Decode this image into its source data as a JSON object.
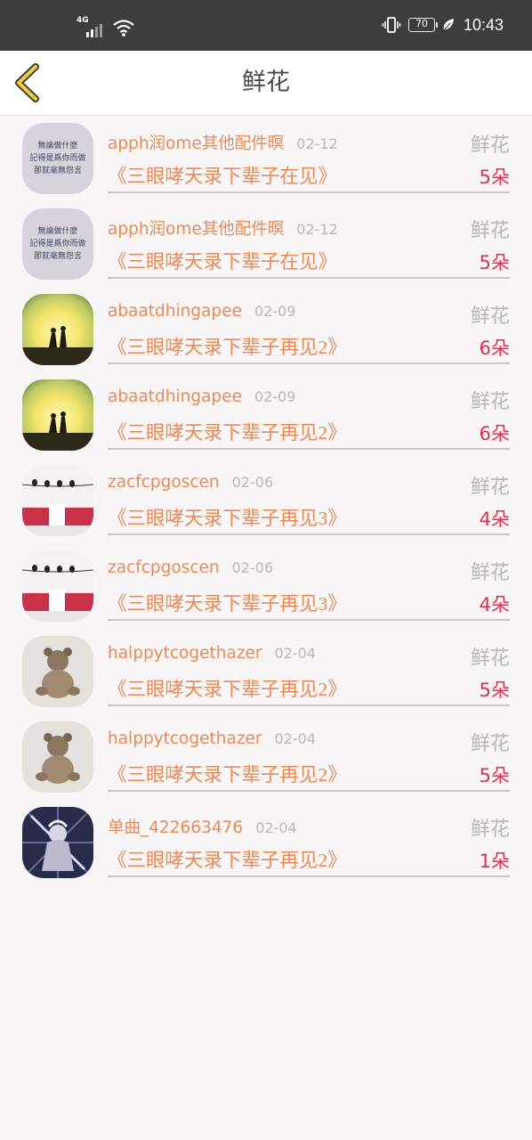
{
  "status_bar": {
    "network": "4G",
    "battery": "70",
    "time": "10:43"
  },
  "header": {
    "title": "鲜花"
  },
  "records": [
    {
      "avatar": "quote-text-image",
      "avatar_text": [
        "無論做什麼",
        "記得是爲你而做",
        "那就毫無怨言"
      ],
      "user": "apph润ome其他配件暝",
      "date": "02-12",
      "tag": "鲜花",
      "song": "《三眼哮天录下辈子在见》",
      "count": "5朵"
    },
    {
      "avatar": "quote-text-image",
      "avatar_text": [
        "無論做什麼",
        "記得是爲你而做",
        "那就毫無怨言"
      ],
      "user": "apph润ome其他配件暝",
      "date": "02-12",
      "tag": "鲜花",
      "song": "《三眼哮天录下辈子在见》",
      "count": "5朵"
    },
    {
      "avatar": "sunset-couple-image",
      "user": "abaatdhingapee",
      "date": "02-09",
      "tag": "鲜花",
      "song": "《三眼哮天录下辈子再见2》",
      "count": "6朵"
    },
    {
      "avatar": "sunset-couple-image",
      "user": "abaatdhingapee",
      "date": "02-09",
      "tag": "鲜花",
      "song": "《三眼哮天录下辈子再见2》",
      "count": "6朵"
    },
    {
      "avatar": "birds-wire-image",
      "user": "zacfcpgoscen",
      "date": "02-06",
      "tag": "鲜花",
      "song": "《三眼哮天录下辈子再见3》",
      "count": "4朵"
    },
    {
      "avatar": "birds-wire-image",
      "user": "zacfcpgoscen",
      "date": "02-06",
      "tag": "鲜花",
      "song": "《三眼哮天录下辈子再见3》",
      "count": "4朵"
    },
    {
      "avatar": "teddy-bear-image",
      "user": "halppytcogethazer",
      "date": "02-04",
      "tag": "鲜花",
      "song": "《三眼哮天录下辈子再见2》",
      "count": "5朵"
    },
    {
      "avatar": "teddy-bear-image",
      "user": "halppytcogethazer",
      "date": "02-04",
      "tag": "鲜花",
      "song": "《三眼哮天录下辈子再见2》",
      "count": "5朵"
    },
    {
      "avatar": "anime-art-image",
      "user": "单曲_422663476",
      "date": "02-04",
      "tag": "鲜花",
      "song": "《三眼哮天录下辈子再见2》",
      "count": "1朵"
    }
  ],
  "colors": {
    "accent": "#eb8a55",
    "count": "#d9334a",
    "muted": "#b8b8b8",
    "status_bar": "#3d3d3d",
    "background": "#f7f5f6"
  }
}
